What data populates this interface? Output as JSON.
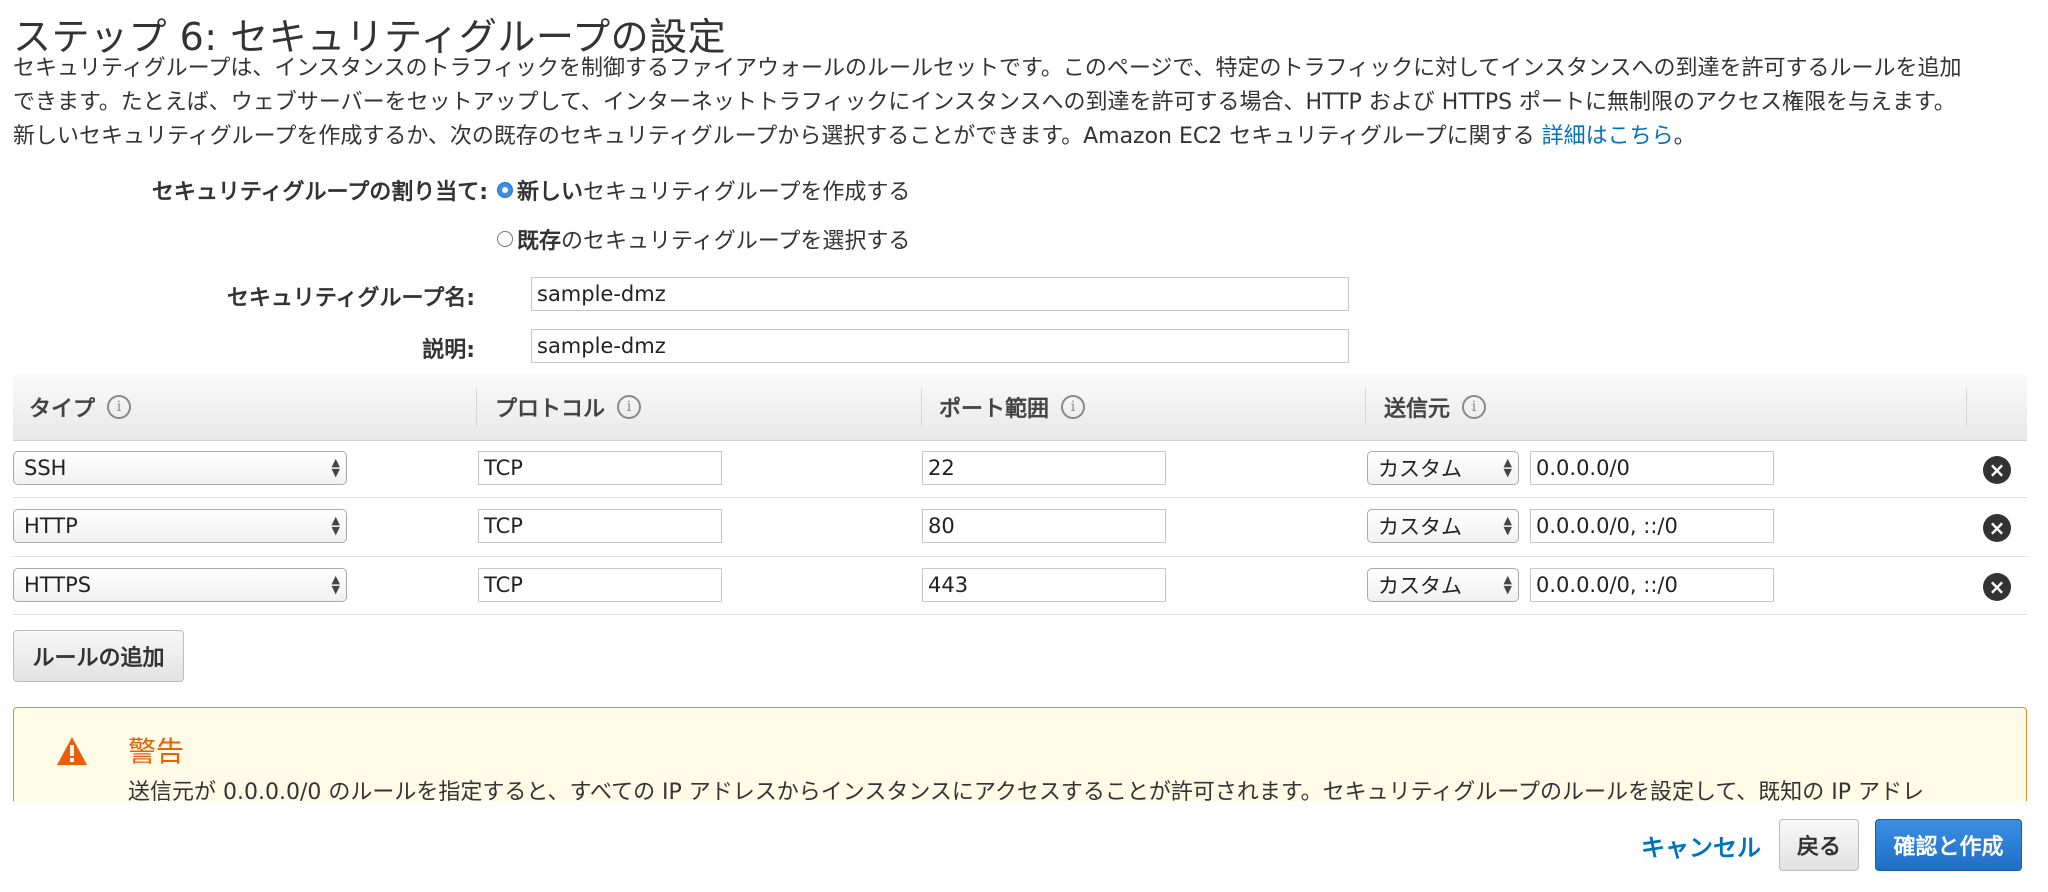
{
  "page": {
    "title": "ステップ 6: セキュリティグループの設定",
    "description_lines": [
      "セキュリティグループは、インスタンスのトラフィックを制御するファイアウォールのルールセットです。このページで、特定のトラフィックに対してインスタンスへの到達を許可するルールを追加",
      "できます。たとえば、ウェブサーバーをセットアップして、インターネットトラフィックにインスタンスへの到達を許可する場合、HTTP および HTTPS ポートに無制限のアクセス権限を与えます。",
      "新しいセキュリティグループを作成するか、次の既存のセキュリティグループから選択することができます。Amazon EC2 セキュリティグループに関する "
    ],
    "details_link": "詳細はこちら",
    "details_suffix": "。"
  },
  "assignment": {
    "label": "セキュリティグループの割り当て:",
    "options": [
      {
        "bold": "新しい",
        "rest": "セキュリティグループを作成する",
        "selected": true
      },
      {
        "bold": "既存",
        "rest": "のセキュリティグループを選択する",
        "selected": false
      }
    ]
  },
  "form": {
    "name_label": "セキュリティグループ名:",
    "name_value": "sample-dmz",
    "desc_label": "説明:",
    "desc_value": "sample-dmz"
  },
  "table": {
    "headers": {
      "type": "タイプ",
      "protocol": "プロトコル",
      "port": "ポート範囲",
      "source": "送信元"
    },
    "info_glyph": "i",
    "rows": [
      {
        "type": "SSH",
        "protocol": "TCP",
        "port": "22",
        "source_type": "カスタム",
        "source": "0.0.0.0/0"
      },
      {
        "type": "HTTP",
        "protocol": "TCP",
        "port": "80",
        "source_type": "カスタム",
        "source": "0.0.0.0/0, ::/0"
      },
      {
        "type": "HTTPS",
        "protocol": "TCP",
        "port": "443",
        "source_type": "カスタム",
        "source": "0.0.0.0/0, ::/0"
      }
    ],
    "remove_glyph": "×"
  },
  "add_rule_label": "ルールの追加",
  "warning": {
    "title": "警告",
    "icon_glyph": "!",
    "text": "送信元が 0.0.0.0/0 のルールを指定すると、すべての IP アドレスからインスタンスにアクセスすることが許可されます。セキュリティグループのルールを設定して、既知の IP アドレ"
  },
  "footer": {
    "cancel_label": "キャンセル",
    "back_label": "戻る",
    "review_label": "確認と作成"
  },
  "colors": {
    "accent_blue": "#0073bb",
    "primary_button": "#1f6ec5",
    "warning_border": "#eb8c26",
    "warning_title": "#eb5f07",
    "warning_bg": "#fffbe6"
  }
}
